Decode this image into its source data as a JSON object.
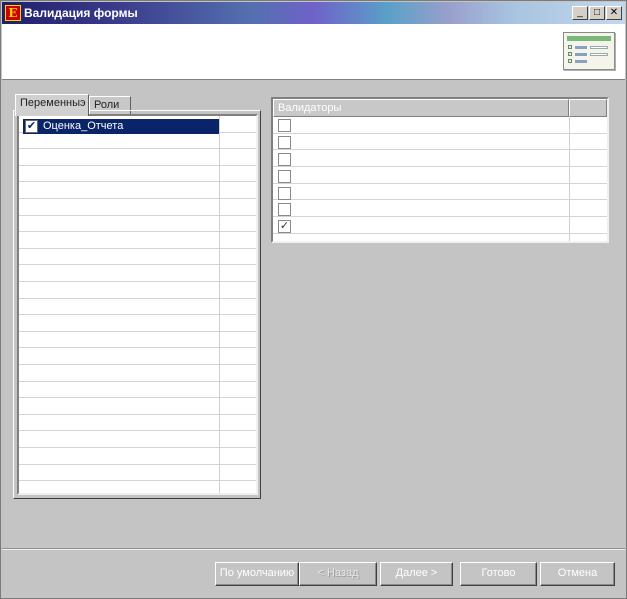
{
  "window": {
    "title": "Валидация формы",
    "app_icon_glyph": "E",
    "controls": {
      "minimize": "_",
      "maximize": "□",
      "close": "✕"
    }
  },
  "tabs": [
    {
      "label": "Переменныэ",
      "active": true
    },
    {
      "label": "Роли",
      "active": false
    }
  ],
  "variables": {
    "rows": [
      {
        "label": "Оценка_Отчета",
        "checked": true,
        "selected": true
      }
    ],
    "check_mark": "✔"
  },
  "validators": {
    "column_header": "Валидаторы",
    "rows": [
      {
        "checked": false,
        "mark": ""
      },
      {
        "checked": false,
        "mark": ""
      },
      {
        "checked": false,
        "mark": ""
      },
      {
        "checked": false,
        "mark": ""
      },
      {
        "checked": false,
        "mark": ""
      },
      {
        "checked": false,
        "mark": ""
      },
      {
        "checked": true,
        "mark": "✓"
      }
    ]
  },
  "buttons": {
    "default": "По умолчанию",
    "back": "< Назад",
    "next": "Далее >",
    "finish": "Готово",
    "cancel": "Отмена"
  },
  "colors": {
    "selection": "#0a246a",
    "window_bg": "#c4c4c4"
  }
}
